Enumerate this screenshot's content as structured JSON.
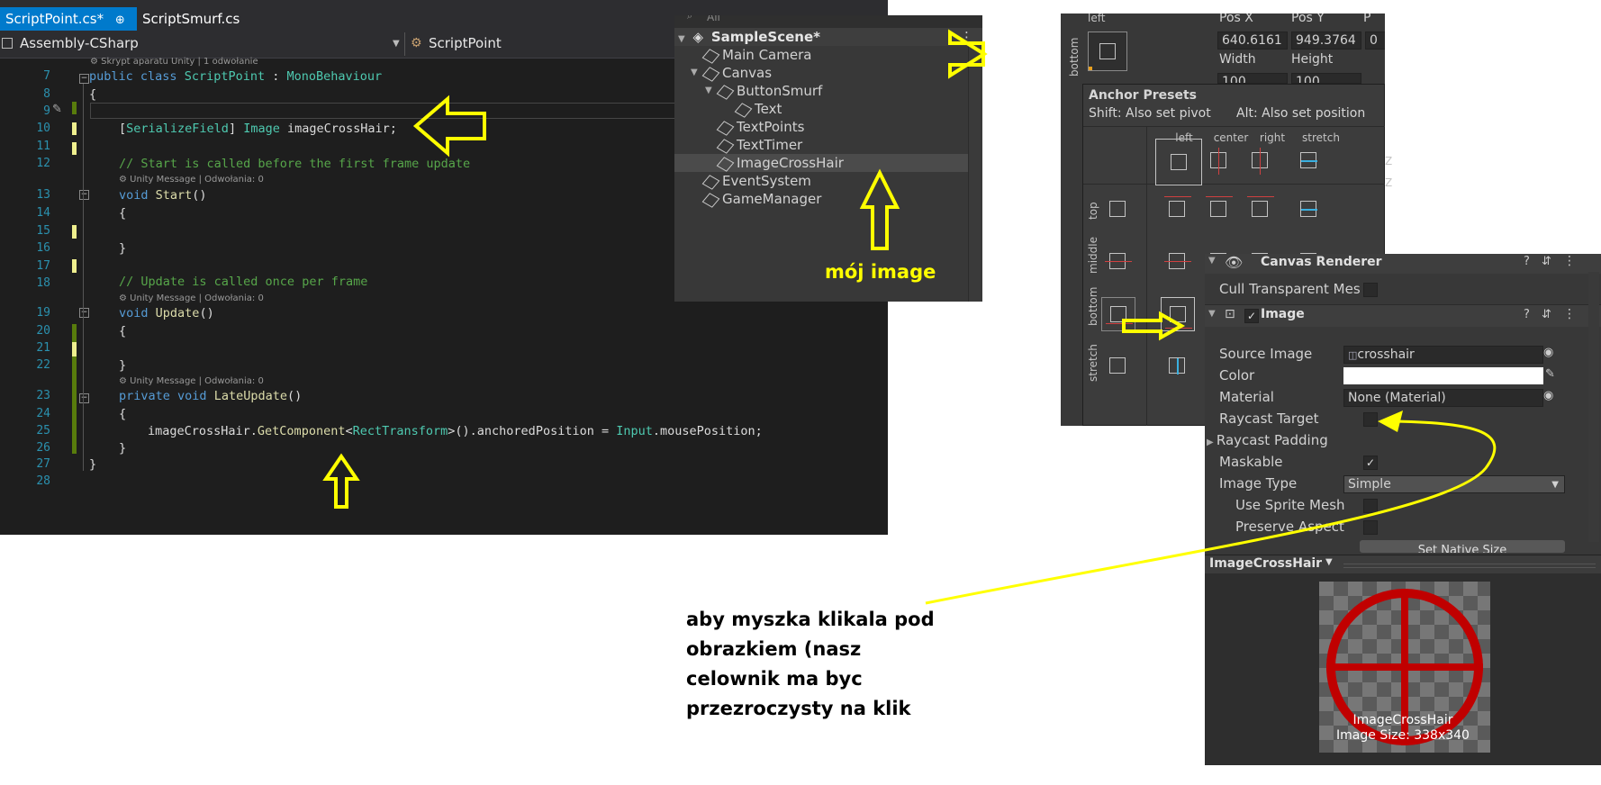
{
  "vs": {
    "tabs": [
      {
        "label": "ScriptPoint.cs*",
        "pin": "⊕",
        "close": "×"
      },
      {
        "label": "ScriptSmurf.cs"
      }
    ],
    "nav": {
      "project": "Assembly-CSharp",
      "class": "ScriptPoint"
    },
    "lens": {
      "top": "Skrypt aparatu Unity | 1 odwołanie",
      "start": "Unity Message | Odwołania: 0",
      "update": "Unity Message | Odwołania: 0",
      "late": "Unity Message | Odwołania: 0"
    },
    "line_numbers": [
      "7",
      "8",
      "9",
      "10",
      "11",
      "12",
      "13",
      "14",
      "15",
      "16",
      "17",
      "18",
      "19",
      "20",
      "21",
      "22",
      "23",
      "24",
      "25",
      "26",
      "27",
      "28"
    ],
    "code": {
      "l7_kw": "public class",
      "l7_name": "ScriptPoint",
      "l7_sep": " : ",
      "l7_base": "MonoBehaviour",
      "l8": "{",
      "l10_attr": "SerializeField",
      "l10_type": "Image",
      "l10_rest": " imageCrossHair;",
      "l12": "// Start is called before the first frame update",
      "l13_kw": "void",
      "l13_name": "Start",
      "l13_rest": "()",
      "l14": "{",
      "l16": "}",
      "l18": "// Update is called once per frame",
      "l19_kw": "void",
      "l19_name": "Update",
      "l19_rest": "()",
      "l20": "{",
      "l22": "}",
      "l23_kw": "private void",
      "l23_name": "LateUpdate",
      "l23_rest": "()",
      "l24": "{",
      "l25_a": "imageCrossHair.",
      "l25_m": "GetComponent",
      "l25_b": "<",
      "l25_t": "RectTransform",
      "l25_c": ">().anchoredPosition = ",
      "l25_i": "Input",
      "l25_d": ".mousePosition;",
      "l26": "}",
      "l27": "}"
    }
  },
  "hierarchy": {
    "search_placeholder": "All",
    "scene": "SampleScene*",
    "items": [
      {
        "label": "Main Camera"
      },
      {
        "label": "Canvas"
      },
      {
        "label": "ButtonSmurf"
      },
      {
        "label": "Text"
      },
      {
        "label": "TextPoints"
      },
      {
        "label": "TextTimer"
      },
      {
        "label": "ImageCrossHair"
      },
      {
        "label": "EventSystem"
      },
      {
        "label": "GameManager"
      }
    ]
  },
  "rect_transform": {
    "anchor_label": "left",
    "side_label": "bottom",
    "pos_x_label": "Pos X",
    "pos_y_label": "Pos Y",
    "pos_z_label": "P",
    "pos_x": "640.6161",
    "pos_y": "949.3764",
    "pos_z": "0",
    "width_label": "Width",
    "height_label": "Height",
    "width": "100",
    "height": "100"
  },
  "anchor_presets": {
    "title": "Anchor Presets",
    "hint_shift": "Shift: Also set pivot",
    "hint_alt": "Alt: Also set position",
    "cols": [
      "left",
      "center",
      "right",
      "stretch"
    ],
    "rows": [
      "top",
      "middle",
      "bottom",
      "stretch"
    ]
  },
  "inspector": {
    "canvas_renderer": "Canvas Renderer",
    "cull": "Cull Transparent Mes",
    "image_header": "Image",
    "source_image_label": "Source Image",
    "source_image": "crosshair",
    "color_label": "Color",
    "material_label": "Material",
    "material": "None (Material)",
    "raycast_target": "Raycast Target",
    "raycast_padding": "Raycast Padding",
    "maskable": "Maskable",
    "image_type_label": "Image Type",
    "image_type": "Simple",
    "use_sprite_mesh": "Use Sprite Mesh",
    "preserve_aspect": "Preserve Aspect",
    "set_native_size": "Set Native Size",
    "preview_title": "ImageCrossHair",
    "preview_name": "ImageCrossHair",
    "preview_size": "Image Size: 338x340",
    "side_z1": "Z",
    "side_z2": "Z"
  },
  "annotations": {
    "moj_image": "mój image",
    "note_lines": [
      "aby myszka klikala pod",
      "obrazkiem (nasz",
      "celownik ma byc",
      "przezroczysty na klik"
    ]
  },
  "colors": {
    "annotation": "#ffff00",
    "vs_tab_active": "#007acc",
    "crosshair": "#c00000"
  }
}
